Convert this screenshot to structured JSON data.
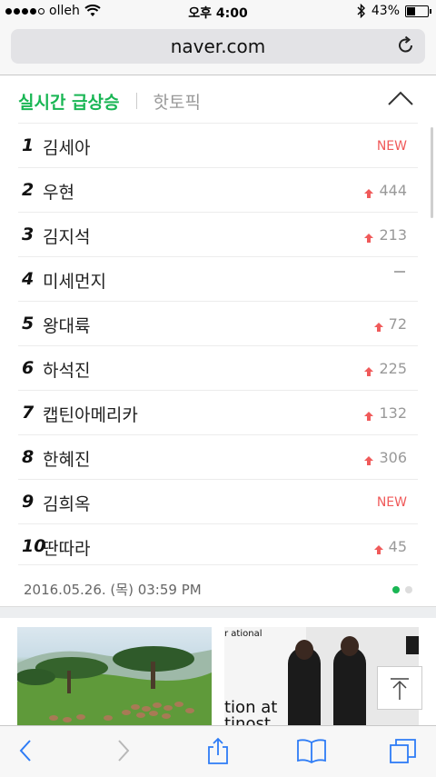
{
  "status_bar": {
    "carrier": "olleh",
    "time": "오후 4:00",
    "battery": "43%",
    "battery_level": 0.43
  },
  "browser": {
    "url": "naver.com"
  },
  "trending": {
    "tab_active": "실시간 급상승",
    "tab_other": "핫토픽",
    "items": [
      {
        "rank": "1",
        "keyword": "김세아",
        "change": "NEW",
        "type": "new"
      },
      {
        "rank": "2",
        "keyword": "우현",
        "change": "444",
        "type": "up"
      },
      {
        "rank": "3",
        "keyword": "김지석",
        "change": "213",
        "type": "up"
      },
      {
        "rank": "4",
        "keyword": "미세먼지",
        "change": "",
        "type": "same"
      },
      {
        "rank": "5",
        "keyword": "왕대륙",
        "change": "72",
        "type": "up"
      },
      {
        "rank": "6",
        "keyword": "하석진",
        "change": "225",
        "type": "up"
      },
      {
        "rank": "7",
        "keyword": "캡틴아메리카",
        "change": "132",
        "type": "up"
      },
      {
        "rank": "8",
        "keyword": "한혜진",
        "change": "306",
        "type": "up"
      },
      {
        "rank": "9",
        "keyword": "김희옥",
        "change": "NEW",
        "type": "new"
      },
      {
        "rank": "10",
        "keyword": "딴따라",
        "change": "45",
        "type": "up"
      }
    ],
    "timestamp": "2016.05.26. (목) 03:59 PM",
    "page": 1,
    "page_count": 2
  },
  "thumbnails": {
    "second_caption_line1": "tion at",
    "second_caption_line2": "tinost",
    "second_caption_top": "r\national"
  },
  "colors": {
    "accent": "#19b654",
    "up": "#f05a5a",
    "ios_blue": "#2e7cf6"
  },
  "icons": [
    "wifi-icon",
    "bluetooth-icon",
    "reload-icon",
    "chevron-up-icon",
    "arrow-up-icon",
    "back-icon",
    "forward-icon",
    "share-icon",
    "bookmarks-icon",
    "tabs-icon",
    "scroll-top-icon"
  ]
}
